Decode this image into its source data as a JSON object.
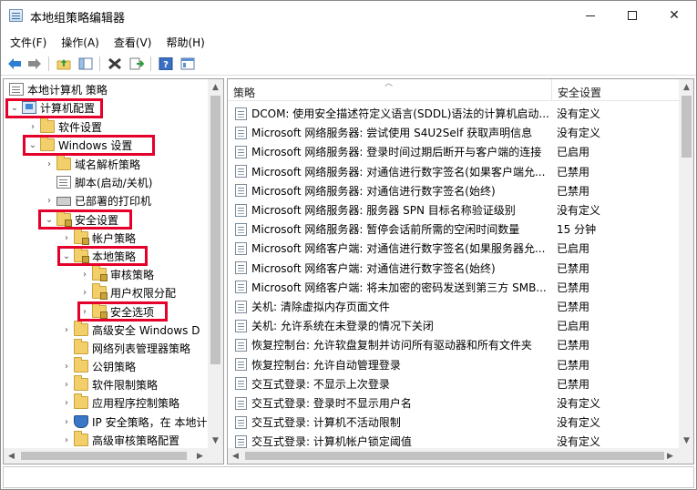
{
  "window": {
    "title": "本地组策略编辑器",
    "controls": {
      "minimize": "",
      "maximize": "",
      "close": "✕"
    }
  },
  "menu": [
    "文件(F)",
    "操作(A)",
    "查看(V)",
    "帮助(H)"
  ],
  "toolbar": {
    "icons": [
      "back-arrow-icon",
      "forward-arrow-icon",
      "up-folder-icon",
      "show-hide-tree-icon",
      "delete-icon",
      "export-list-icon",
      "help-icon",
      "properties-icon"
    ]
  },
  "tree": {
    "items": [
      {
        "label": "本地计算机 策略",
        "icon": "doc-icon",
        "caret": "",
        "highlighted": false
      },
      {
        "label": "计算机配置",
        "icon": "computer-icon",
        "caret": "⌄",
        "highlighted": true
      },
      {
        "label": "软件设置",
        "icon": "folder-icon",
        "caret": "›",
        "highlighted": false
      },
      {
        "label": "Windows 设置",
        "icon": "folder-icon",
        "caret": "⌄",
        "highlighted": true
      },
      {
        "label": "域名解析策略",
        "icon": "folder-icon",
        "caret": "›",
        "highlighted": false
      },
      {
        "label": "脚本(启动/关机)",
        "icon": "script-icon",
        "caret": "",
        "highlighted": false
      },
      {
        "label": "已部署的打印机",
        "icon": "printer-icon",
        "caret": "›",
        "highlighted": false
      },
      {
        "label": "安全设置",
        "icon": "security-icon",
        "caret": "⌄",
        "highlighted": true
      },
      {
        "label": "帐户策略",
        "icon": "folder-lock-icon",
        "caret": "›",
        "highlighted": false
      },
      {
        "label": "本地策略",
        "icon": "folder-lock-icon",
        "caret": "⌄",
        "highlighted": true
      },
      {
        "label": "审核策略",
        "icon": "folder-lock-icon",
        "caret": "›",
        "highlighted": false
      },
      {
        "label": "用户权限分配",
        "icon": "folder-lock-icon",
        "caret": "›",
        "highlighted": false
      },
      {
        "label": "安全选项",
        "icon": "folder-lock-icon",
        "caret": "›",
        "highlighted": true
      },
      {
        "label": "高级安全 Windows D",
        "icon": "folder-icon",
        "caret": "›",
        "highlighted": false
      },
      {
        "label": "网络列表管理器策略",
        "icon": "folder-icon",
        "caret": "",
        "highlighted": false
      },
      {
        "label": "公钥策略",
        "icon": "folder-icon",
        "caret": "›",
        "highlighted": false
      },
      {
        "label": "软件限制策略",
        "icon": "folder-icon",
        "caret": "›",
        "highlighted": false
      },
      {
        "label": "应用程序控制策略",
        "icon": "folder-icon",
        "caret": "›",
        "highlighted": false
      },
      {
        "label": "IP 安全策略，在 本地计",
        "icon": "shield-icon",
        "caret": "›",
        "highlighted": false
      },
      {
        "label": "高级审核策略配置",
        "icon": "folder-icon",
        "caret": "›",
        "highlighted": false
      }
    ]
  },
  "list": {
    "columns": {
      "policy": "策略",
      "setting": "安全设置"
    },
    "rows": [
      {
        "policy": "DCOM: 使用安全描述符定义语言(SDDL)语法的计算机启动...",
        "setting": "没有定义"
      },
      {
        "policy": "Microsoft 网络服务器: 尝试使用 S4U2Self 获取声明信息",
        "setting": "没有定义"
      },
      {
        "policy": "Microsoft 网络服务器: 登录时间过期后断开与客户端的连接",
        "setting": "已启用"
      },
      {
        "policy": "Microsoft 网络服务器: 对通信进行数字签名(如果客户端允...",
        "setting": "已禁用"
      },
      {
        "policy": "Microsoft 网络服务器: 对通信进行数字签名(始终)",
        "setting": "已禁用"
      },
      {
        "policy": "Microsoft 网络服务器: 服务器 SPN 目标名称验证级别",
        "setting": "没有定义"
      },
      {
        "policy": "Microsoft 网络服务器: 暂停会话前所需的空闲时间数量",
        "setting": "15 分钟"
      },
      {
        "policy": "Microsoft 网络客户端: 对通信进行数字签名(如果服务器允...",
        "setting": "已启用"
      },
      {
        "policy": "Microsoft 网络客户端: 对通信进行数字签名(始终)",
        "setting": "已禁用"
      },
      {
        "policy": "Microsoft 网络客户端: 将未加密的密码发送到第三方 SMB...",
        "setting": "已禁用"
      },
      {
        "policy": "关机: 清除虚拟内存页面文件",
        "setting": "已禁用"
      },
      {
        "policy": "关机: 允许系统在未登录的情况下关闭",
        "setting": "已启用"
      },
      {
        "policy": "恢复控制台: 允许软盘复制并访问所有驱动器和所有文件夹",
        "setting": "已禁用"
      },
      {
        "policy": "恢复控制台: 允许自动管理登录",
        "setting": "已禁用"
      },
      {
        "policy": "交互式登录: 不显示上次登录",
        "setting": "已禁用"
      },
      {
        "policy": "交互式登录: 登录时不显示用户名",
        "setting": "没有定义"
      },
      {
        "policy": "交互式登录: 计算机不活动限制",
        "setting": "没有定义"
      },
      {
        "policy": "交互式登录: 计算机帐户锁定阈值",
        "setting": "没有定义"
      }
    ]
  },
  "colors": {
    "highlight": "#e4002b",
    "accent": "#3a77c8"
  }
}
